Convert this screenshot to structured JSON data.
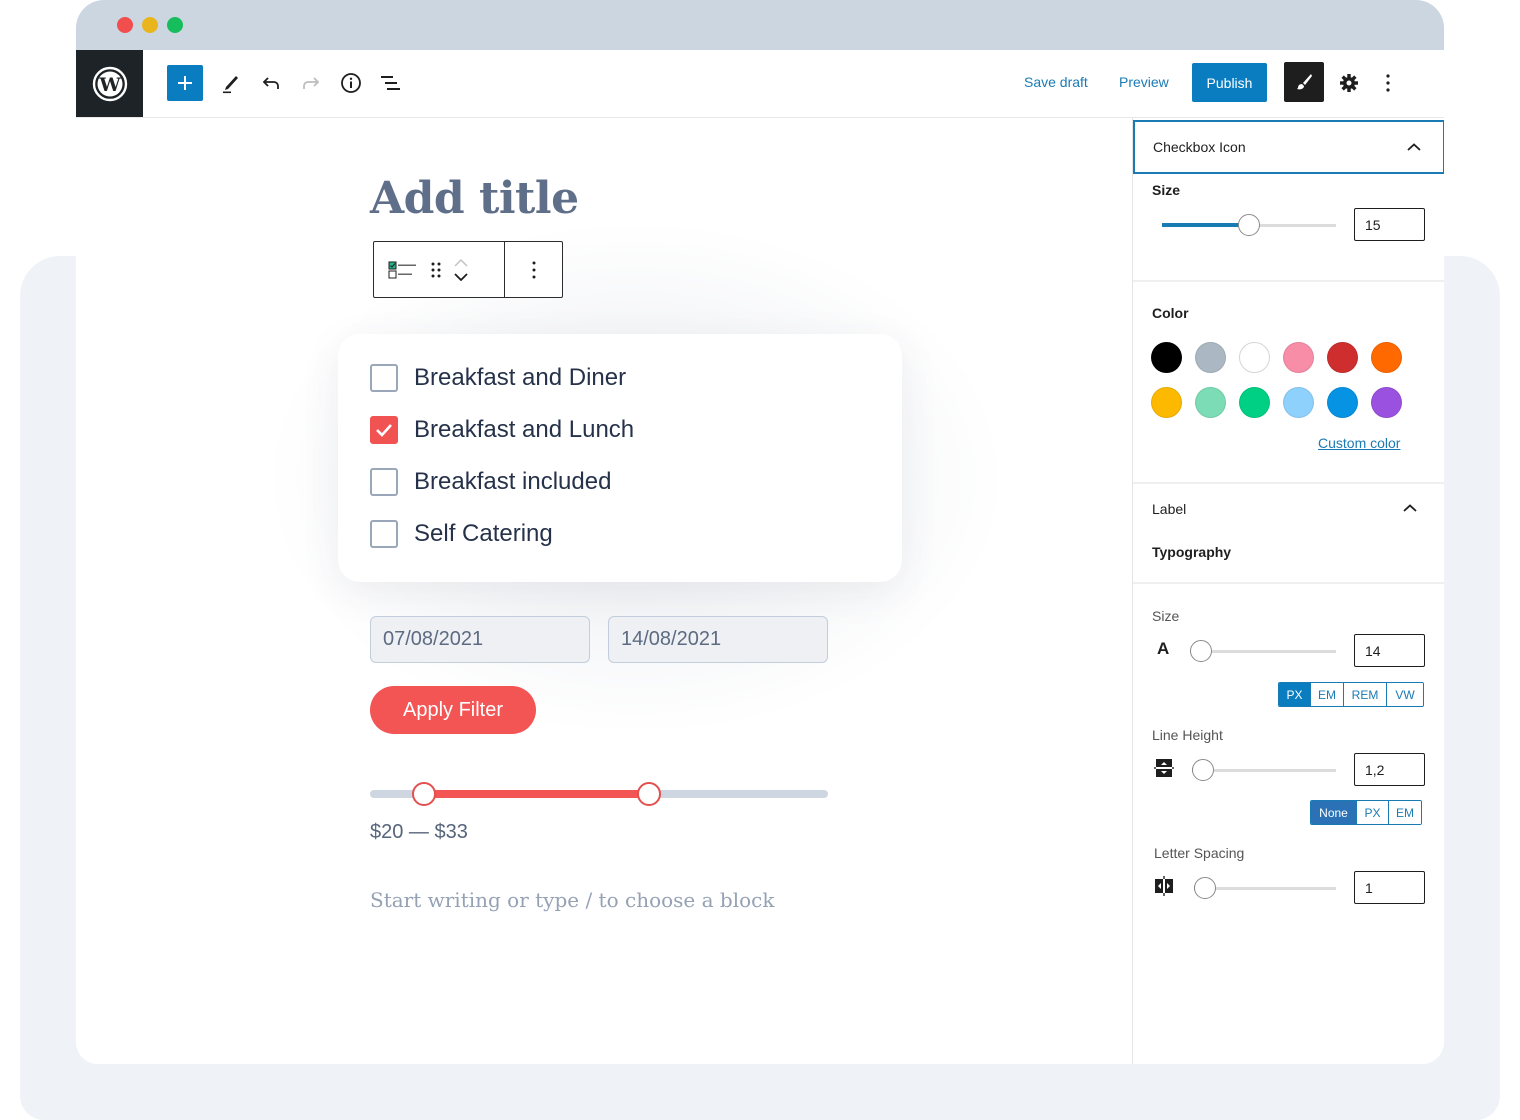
{
  "window": {
    "controls": [
      "close",
      "minimize",
      "maximize"
    ]
  },
  "toolbar": {
    "logo_icon": "wordpress-logo",
    "icons": [
      "plus-icon",
      "pencil-icon",
      "undo-icon",
      "redo-icon",
      "info-icon",
      "list-view-icon"
    ],
    "save_draft_label": "Save draft",
    "preview_label": "Preview",
    "publish_label": "Publish",
    "right_icons": [
      "brush-icon",
      "gear-icon",
      "more-vertical-icon"
    ]
  },
  "editor": {
    "title_placeholder": "Add title",
    "block_toolbar": {
      "icons": [
        "checkbox-list-icon",
        "drag-handle-icon",
        "move-up-icon",
        "move-down-icon",
        "more-vertical-icon"
      ]
    },
    "checkbox_filter": {
      "options": [
        {
          "label": "Breakfast and Diner",
          "checked": false
        },
        {
          "label": "Breakfast and Lunch",
          "checked": true
        },
        {
          "label": "Breakfast included",
          "checked": false
        },
        {
          "label": "Self Catering",
          "checked": false
        }
      ]
    },
    "date_from": "07/08/2021",
    "date_to": "14/08/2021",
    "apply_label": "Apply Filter",
    "price_range": {
      "min_fraction": 0.117,
      "max_fraction": 0.61,
      "label": "$20 — $33"
    },
    "block_placeholder": "Start writing or type / to choose a block",
    "accent_color": "#f35454"
  },
  "sidebar": {
    "checkbox_icon_panel": {
      "title": "Checkbox Icon",
      "size_label": "Size",
      "size_value": "15",
      "size_fraction": 0.5,
      "color_label": "Color",
      "colors": [
        "#000000",
        "#abb8c3",
        "#ffffff",
        "#f78da7",
        "#cf2e2e",
        "#ff6900",
        "#fcb900",
        "#7bdcb5",
        "#00d084",
        "#8ed1fc",
        "#0693e3",
        "#9b51e0"
      ],
      "custom_color_label": "Custom color"
    },
    "label_panel": {
      "title": "Label",
      "typography_label": "Typography",
      "font_size_label": "Size",
      "font_size_icon_text": "A",
      "font_size_value": "14",
      "font_size_fraction": 0.0,
      "font_size_units": [
        "PX",
        "EM",
        "REM",
        "VW"
      ],
      "font_size_unit_active": "PX",
      "line_height_label": "Line Height",
      "line_height_value": "1,2",
      "line_height_fraction": 0.05,
      "line_height_units": [
        "None",
        "PX",
        "EM"
      ],
      "line_height_unit_active": "None",
      "letter_spacing_label": "Letter Spacing",
      "letter_spacing_value": "1",
      "letter_spacing_fraction": 0.07
    },
    "brand_color": "#0a7dc0"
  }
}
